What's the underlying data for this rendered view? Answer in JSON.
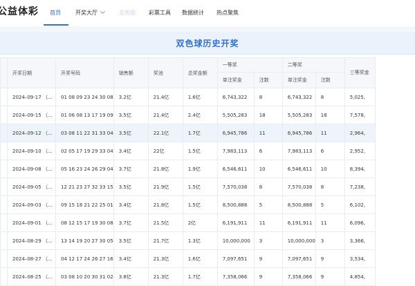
{
  "nav": {
    "logo": "公益体彩",
    "items": [
      {
        "label": "首页",
        "state": "active"
      },
      {
        "label": "开奖大厅",
        "state": "normal"
      },
      {
        "label": "走势图",
        "state": "faded"
      },
      {
        "label": "彩票工具",
        "state": "normal"
      },
      {
        "label": "数据统计",
        "state": "normal"
      },
      {
        "label": "热点聚焦",
        "state": "normal"
      }
    ]
  },
  "banner": {
    "title": "双色球历史开奖"
  },
  "table": {
    "headers": {
      "date": "开奖日期",
      "numbers": "开奖号码",
      "sales": "销售额",
      "pool": "奖池",
      "total_prize": "总奖金额",
      "first_prize": "一等奖",
      "second_prize": "二等奖",
      "third_prize": "三等奖金",
      "unit_prize": "单注奖金",
      "count": "注数"
    },
    "rows": [
      {
        "date": "2024–09-17 （...",
        "numbers": "01 08 09 23 24 30 08",
        "sales": "3.2亿",
        "pool": "21.4亿",
        "total": "1.6亿",
        "p1": "6,743,322",
        "n1": "8",
        "p2": "6,743,322",
        "n2": "8",
        "p3": "5,025,"
      },
      {
        "date": "2024–09-15 （...",
        "numbers": "01 06 08 13 17 19 09",
        "sales": "3.5亿",
        "pool": "21.4亿",
        "total": "2.4亿",
        "p1": "5,505,283",
        "n1": "18",
        "p2": "5,505,283",
        "n2": "18",
        "p3": "7,578,"
      },
      {
        "date": "2024–09-12 （...",
        "numbers": "03 08 11 22 31 33 04",
        "sales": "3.5亿",
        "pool": "22.1亿",
        "total": "1.7亿",
        "p1": "6,945,786",
        "n1": "11",
        "p2": "6,945,786",
        "n2": "11",
        "p3": "2,964,"
      },
      {
        "date": "2024–09-10 （...",
        "numbers": "02 05 17 19 29 33 04",
        "sales": "3.4亿",
        "pool": "22亿",
        "total": "1.5亿",
        "p1": "7,983,113",
        "n1": "6",
        "p2": "7,983,113",
        "n2": "6",
        "p3": "2,952,"
      },
      {
        "date": "2024–09-08 （...",
        "numbers": "05 16 23 24 26 29 04",
        "sales": "3.7亿",
        "pool": "21.8亿",
        "total": "1.9亿",
        "p1": "6,546,611",
        "n1": "10",
        "p2": "6,546,611",
        "n2": "10",
        "p3": "8,394,"
      },
      {
        "date": "2024–09-05 （...",
        "numbers": "12 21 23 27 32 33 15",
        "sales": "3.5亿",
        "pool": "21.9亿",
        "total": "1.5亿",
        "p1": "7,570,038",
        "n1": "8",
        "p2": "7,570,038",
        "n2": "8",
        "p3": "7,238,"
      },
      {
        "date": "2024–09-03 （...",
        "numbers": "09 15 18 21 22 25 01",
        "sales": "3.4亿",
        "pool": "21.8亿",
        "total": "1.5亿",
        "p1": "8,500,888",
        "n1": "5",
        "p2": "8,500,888",
        "n2": "5",
        "p3": "6,102,"
      },
      {
        "date": "2024–09-01 （...",
        "numbers": "08 12 15 17 19 30 08",
        "sales": "3.7亿",
        "pool": "21.5亿",
        "total": "2亿",
        "p1": "6,191,911",
        "n1": "11",
        "p2": "6,191,911",
        "n2": "11",
        "p3": "6,096,"
      },
      {
        "date": "2024–08-29 （...",
        "numbers": "13 14 19 20 27 30 05",
        "sales": "3.5亿",
        "pool": "21.7亿",
        "total": "1.3亿",
        "p1": "10,000,000",
        "n1": "3",
        "p2": "10,000,000",
        "n2": "3",
        "p3": "3,366,"
      },
      {
        "date": "2024–08-27 （...",
        "numbers": "04 12 17 24 26 27 16",
        "sales": "3.4亿",
        "pool": "21.3亿",
        "total": "1.6亿",
        "p1": "7,097,651",
        "n1": "9",
        "p2": "7,097,651",
        "n2": "9",
        "p3": "3,534,"
      },
      {
        "date": "2024–08-25 （...",
        "numbers": "03 08 10 20 30 31 02",
        "sales": "3.8亿",
        "pool": "21.3亿",
        "total": "1.7亿",
        "p1": "7,358,066",
        "n1": "9",
        "p2": "7,358,066",
        "n2": "9",
        "p3": "4,854,"
      }
    ]
  }
}
